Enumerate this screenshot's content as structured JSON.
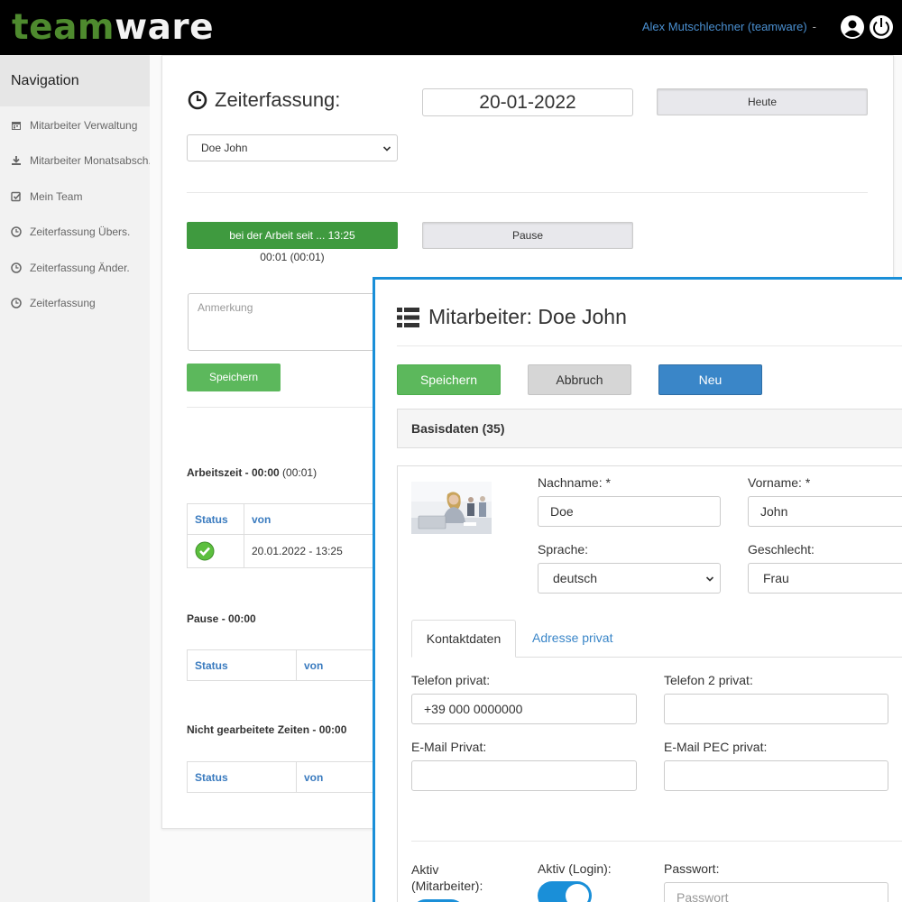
{
  "header": {
    "logo_part1": "team",
    "logo_part2": "ware",
    "user_label": "Alex Mutschlechner (teamware)",
    "separator": "-",
    "icons": [
      "user-circle-icon",
      "power-icon"
    ]
  },
  "sidebar": {
    "title": "Navigation",
    "items": [
      {
        "label": "Mitarbeiter Verwaltung",
        "icon": "calendar-icon"
      },
      {
        "label": "Mitarbeiter Monatsabsch..",
        "icon": "download-icon"
      },
      {
        "label": "Mein Team",
        "icon": "checkbox-icon"
      },
      {
        "label": "Zeiterfassung Übers.",
        "icon": "clock-icon"
      },
      {
        "label": "Zeiterfassung Änder.",
        "icon": "clock-icon"
      },
      {
        "label": "Zeiterfassung",
        "icon": "clock-icon"
      }
    ]
  },
  "timetracking": {
    "title": "Zeiterfassung:",
    "date": "20-01-2022",
    "today_button": "Heute",
    "employee_select": "Doe John",
    "working_button": "bei der Arbeit seit ... 13:25",
    "elapsed": "00:01 (00:01)",
    "pause_button": "Pause",
    "remark_placeholder": "Anmerkung",
    "save_button": "Speichern",
    "worktime_label": "Arbeitszeit - 00:00",
    "worktime_extra": "(00:01)",
    "worktime_table": {
      "headers": [
        "Status",
        "von"
      ],
      "rows": [
        {
          "status_icon": "check-circle-icon",
          "von": "20.01.2022 - 13:25"
        }
      ]
    },
    "pause_label": "Pause - 00:00",
    "pause_table": {
      "headers": [
        "Status",
        "von"
      ]
    },
    "notworked_label": "Nicht gearbeitete Zeiten - 00:00",
    "notworked_table": {
      "headers": [
        "Status",
        "von"
      ]
    }
  },
  "modal": {
    "title": "Mitarbeiter: Doe John",
    "save_button": "Speichern",
    "cancel_button": "Abbruch",
    "new_button": "Neu",
    "panel_title": "Basisdaten (35)",
    "lastname_label": "Nachname: *",
    "lastname_value": "Doe",
    "firstname_label": "Vorname: *",
    "firstname_value": "John",
    "language_label": "Sprache:",
    "language_value": "deutsch",
    "gender_label": "Geschlecht:",
    "gender_value": "Frau",
    "tabs": [
      "Kontaktdaten",
      "Adresse privat"
    ],
    "phone_label": "Telefon privat:",
    "phone_value": "+39 000 0000000",
    "phone2_label": "Telefon 2 privat:",
    "phone2_value": "",
    "email_label": "E-Mail Privat:",
    "email_value": "",
    "pec_label": "E-Mail PEC privat:",
    "pec_value": "",
    "active_employee_label_1": "Aktiv",
    "active_employee_label_2": "(Mitarbeiter):",
    "active_login_label": "Aktiv (Login):",
    "password_label": "Passwort:",
    "password_placeholder": "Passwort"
  },
  "colors": {
    "header_bg": "#000000",
    "logo_green": "#4e8a2e",
    "user_link": "#4a8fd0",
    "success": "#3f9a3f",
    "save_green": "#5cb85c",
    "primary_blue": "#3a86c8",
    "modal_border": "#1a8fd8",
    "table_header": "#3a7bbf"
  }
}
